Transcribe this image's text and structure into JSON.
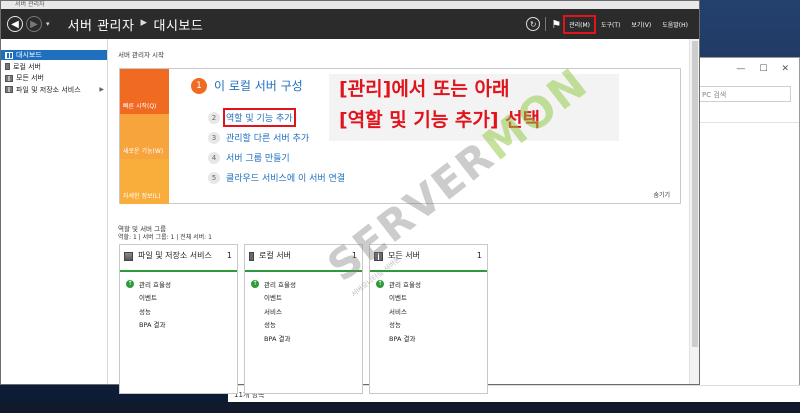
{
  "window": {
    "caption": "서버 관리자",
    "title_main": "서버 관리자",
    "title_arrow": "▸",
    "title_page": "대시보드"
  },
  "header": {
    "menu": [
      "관리(M)",
      "도구(T)",
      "보기(V)",
      "도움말(H)"
    ]
  },
  "sidebar": {
    "items": [
      {
        "label": "대시보드",
        "icon": "dashboard-icon"
      },
      {
        "label": "로컬 서버",
        "icon": "server-icon"
      },
      {
        "label": "모든 서버",
        "icon": "servers-icon"
      },
      {
        "label": "파일 및 저장소 서비스",
        "icon": "folder-icon"
      }
    ]
  },
  "main": {
    "section_title": "서버 관리자 시작",
    "tiles": [
      "빠른 시작(Q)",
      "새로운 기능(W)",
      "자세한 정보(L)"
    ],
    "steps": [
      {
        "num": "1",
        "label": "이 로컬 서버 구성"
      },
      {
        "num": "2",
        "label": "역할 및 기능 추가"
      },
      {
        "num": "3",
        "label": "관리할 다른 서버 추가"
      },
      {
        "num": "4",
        "label": "서버 그룹 만들기"
      },
      {
        "num": "5",
        "label": "클라우드 서비스에 이 서버 연결"
      }
    ],
    "hide_label": "숨기기",
    "note_line1": "[관리]에서 또는 아래",
    "note_line2": "[역할 및 기능 추가] 선택",
    "roles_title": "역할 및 서버 그룹",
    "roles_sub": "역할: 1  |  서버 그룹: 1  |  전체 서버: 1",
    "cards": [
      {
        "title": "파일 및 저장소 서비스",
        "count": "1",
        "rows": [
          "관리 효율성",
          "이벤트",
          "성능",
          "BPA 결과"
        ]
      },
      {
        "title": "로컬 서버",
        "count": "1",
        "rows": [
          "관리 효율성",
          "이벤트",
          "서비스",
          "성능",
          "BPA 결과"
        ]
      },
      {
        "title": "모든 서버",
        "count": "1",
        "rows": [
          "관리 효율성",
          "이벤트",
          "서비스",
          "성능",
          "BPA 결과"
        ]
      }
    ]
  },
  "watermark": {
    "text_a": "SERVER",
    "text_b": "MON",
    "sub": "서버모니터링 서버몬"
  },
  "background_window": {
    "search_placeholder": "PC 검색",
    "status": "11개 항목"
  },
  "colors": {
    "accent": "#1f6fbf",
    "orange": "#f06a22",
    "highlight": "#e0141c",
    "ok": "#2f9a3a"
  }
}
